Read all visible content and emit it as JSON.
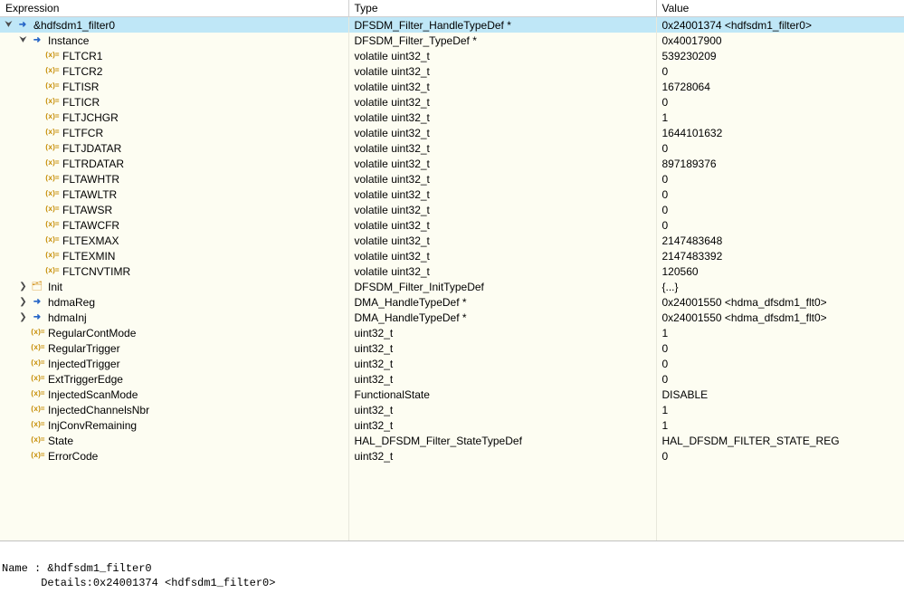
{
  "columns": [
    "Expression",
    "Type",
    "Value"
  ],
  "rows": [
    {
      "level": 0,
      "expander": "open",
      "icon": "ptr",
      "name": "&hdfsdm1_filter0",
      "type": "DFSDM_Filter_HandleTypeDef *",
      "value": "0x24001374 <hdfsdm1_filter0>",
      "selected": true
    },
    {
      "level": 1,
      "expander": "open",
      "icon": "ptr",
      "name": "Instance",
      "type": "DFSDM_Filter_TypeDef *",
      "value": "0x40017900"
    },
    {
      "level": 2,
      "expander": "none",
      "icon": "field",
      "name": "FLTCR1",
      "type": "volatile uint32_t",
      "value": "539230209"
    },
    {
      "level": 2,
      "expander": "none",
      "icon": "field",
      "name": "FLTCR2",
      "type": "volatile uint32_t",
      "value": "0"
    },
    {
      "level": 2,
      "expander": "none",
      "icon": "field",
      "name": "FLTISR",
      "type": "volatile uint32_t",
      "value": "16728064"
    },
    {
      "level": 2,
      "expander": "none",
      "icon": "field",
      "name": "FLTICR",
      "type": "volatile uint32_t",
      "value": "0"
    },
    {
      "level": 2,
      "expander": "none",
      "icon": "field",
      "name": "FLTJCHGR",
      "type": "volatile uint32_t",
      "value": "1"
    },
    {
      "level": 2,
      "expander": "none",
      "icon": "field",
      "name": "FLTFCR",
      "type": "volatile uint32_t",
      "value": "1644101632"
    },
    {
      "level": 2,
      "expander": "none",
      "icon": "field",
      "name": "FLTJDATAR",
      "type": "volatile uint32_t",
      "value": "0"
    },
    {
      "level": 2,
      "expander": "none",
      "icon": "field",
      "name": "FLTRDATAR",
      "type": "volatile uint32_t",
      "value": "897189376"
    },
    {
      "level": 2,
      "expander": "none",
      "icon": "field",
      "name": "FLTAWHTR",
      "type": "volatile uint32_t",
      "value": "0"
    },
    {
      "level": 2,
      "expander": "none",
      "icon": "field",
      "name": "FLTAWLTR",
      "type": "volatile uint32_t",
      "value": "0"
    },
    {
      "level": 2,
      "expander": "none",
      "icon": "field",
      "name": "FLTAWSR",
      "type": "volatile uint32_t",
      "value": "0"
    },
    {
      "level": 2,
      "expander": "none",
      "icon": "field",
      "name": "FLTAWCFR",
      "type": "volatile uint32_t",
      "value": "0"
    },
    {
      "level": 2,
      "expander": "none",
      "icon": "field",
      "name": "FLTEXMAX",
      "type": "volatile uint32_t",
      "value": "2147483648"
    },
    {
      "level": 2,
      "expander": "none",
      "icon": "field",
      "name": "FLTEXMIN",
      "type": "volatile uint32_t",
      "value": "2147483392"
    },
    {
      "level": 2,
      "expander": "none",
      "icon": "field",
      "name": "FLTCNVTIMR",
      "type": "volatile uint32_t",
      "value": "120560"
    },
    {
      "level": 1,
      "expander": "closed",
      "icon": "struct",
      "name": "Init",
      "type": "DFSDM_Filter_InitTypeDef",
      "value": "{...}"
    },
    {
      "level": 1,
      "expander": "closed",
      "icon": "ptr",
      "name": "hdmaReg",
      "type": "DMA_HandleTypeDef *",
      "value": "0x24001550 <hdma_dfsdm1_flt0>"
    },
    {
      "level": 1,
      "expander": "closed",
      "icon": "ptr",
      "name": "hdmaInj",
      "type": "DMA_HandleTypeDef *",
      "value": "0x24001550 <hdma_dfsdm1_flt0>"
    },
    {
      "level": 1,
      "expander": "none",
      "icon": "field",
      "name": "RegularContMode",
      "type": "uint32_t",
      "value": "1"
    },
    {
      "level": 1,
      "expander": "none",
      "icon": "field",
      "name": "RegularTrigger",
      "type": "uint32_t",
      "value": "0"
    },
    {
      "level": 1,
      "expander": "none",
      "icon": "field",
      "name": "InjectedTrigger",
      "type": "uint32_t",
      "value": "0"
    },
    {
      "level": 1,
      "expander": "none",
      "icon": "field",
      "name": "ExtTriggerEdge",
      "type": "uint32_t",
      "value": "0"
    },
    {
      "level": 1,
      "expander": "none",
      "icon": "field",
      "name": "InjectedScanMode",
      "type": "FunctionalState",
      "value": "DISABLE"
    },
    {
      "level": 1,
      "expander": "none",
      "icon": "field",
      "name": "InjectedChannelsNbr",
      "type": "uint32_t",
      "value": "1"
    },
    {
      "level": 1,
      "expander": "none",
      "icon": "field",
      "name": "InjConvRemaining",
      "type": "uint32_t",
      "value": "1"
    },
    {
      "level": 1,
      "expander": "none",
      "icon": "field",
      "name": "State",
      "type": "HAL_DFSDM_Filter_StateTypeDef",
      "value": "HAL_DFSDM_FILTER_STATE_REG"
    },
    {
      "level": 1,
      "expander": "none",
      "icon": "field",
      "name": "ErrorCode",
      "type": "uint32_t",
      "value": "0"
    }
  ],
  "empty_rows": 5,
  "details": {
    "line1": "Name : &hdfsdm1_filter0",
    "line2": "      Details:0x24001374 <hdfsdm1_filter0>"
  }
}
